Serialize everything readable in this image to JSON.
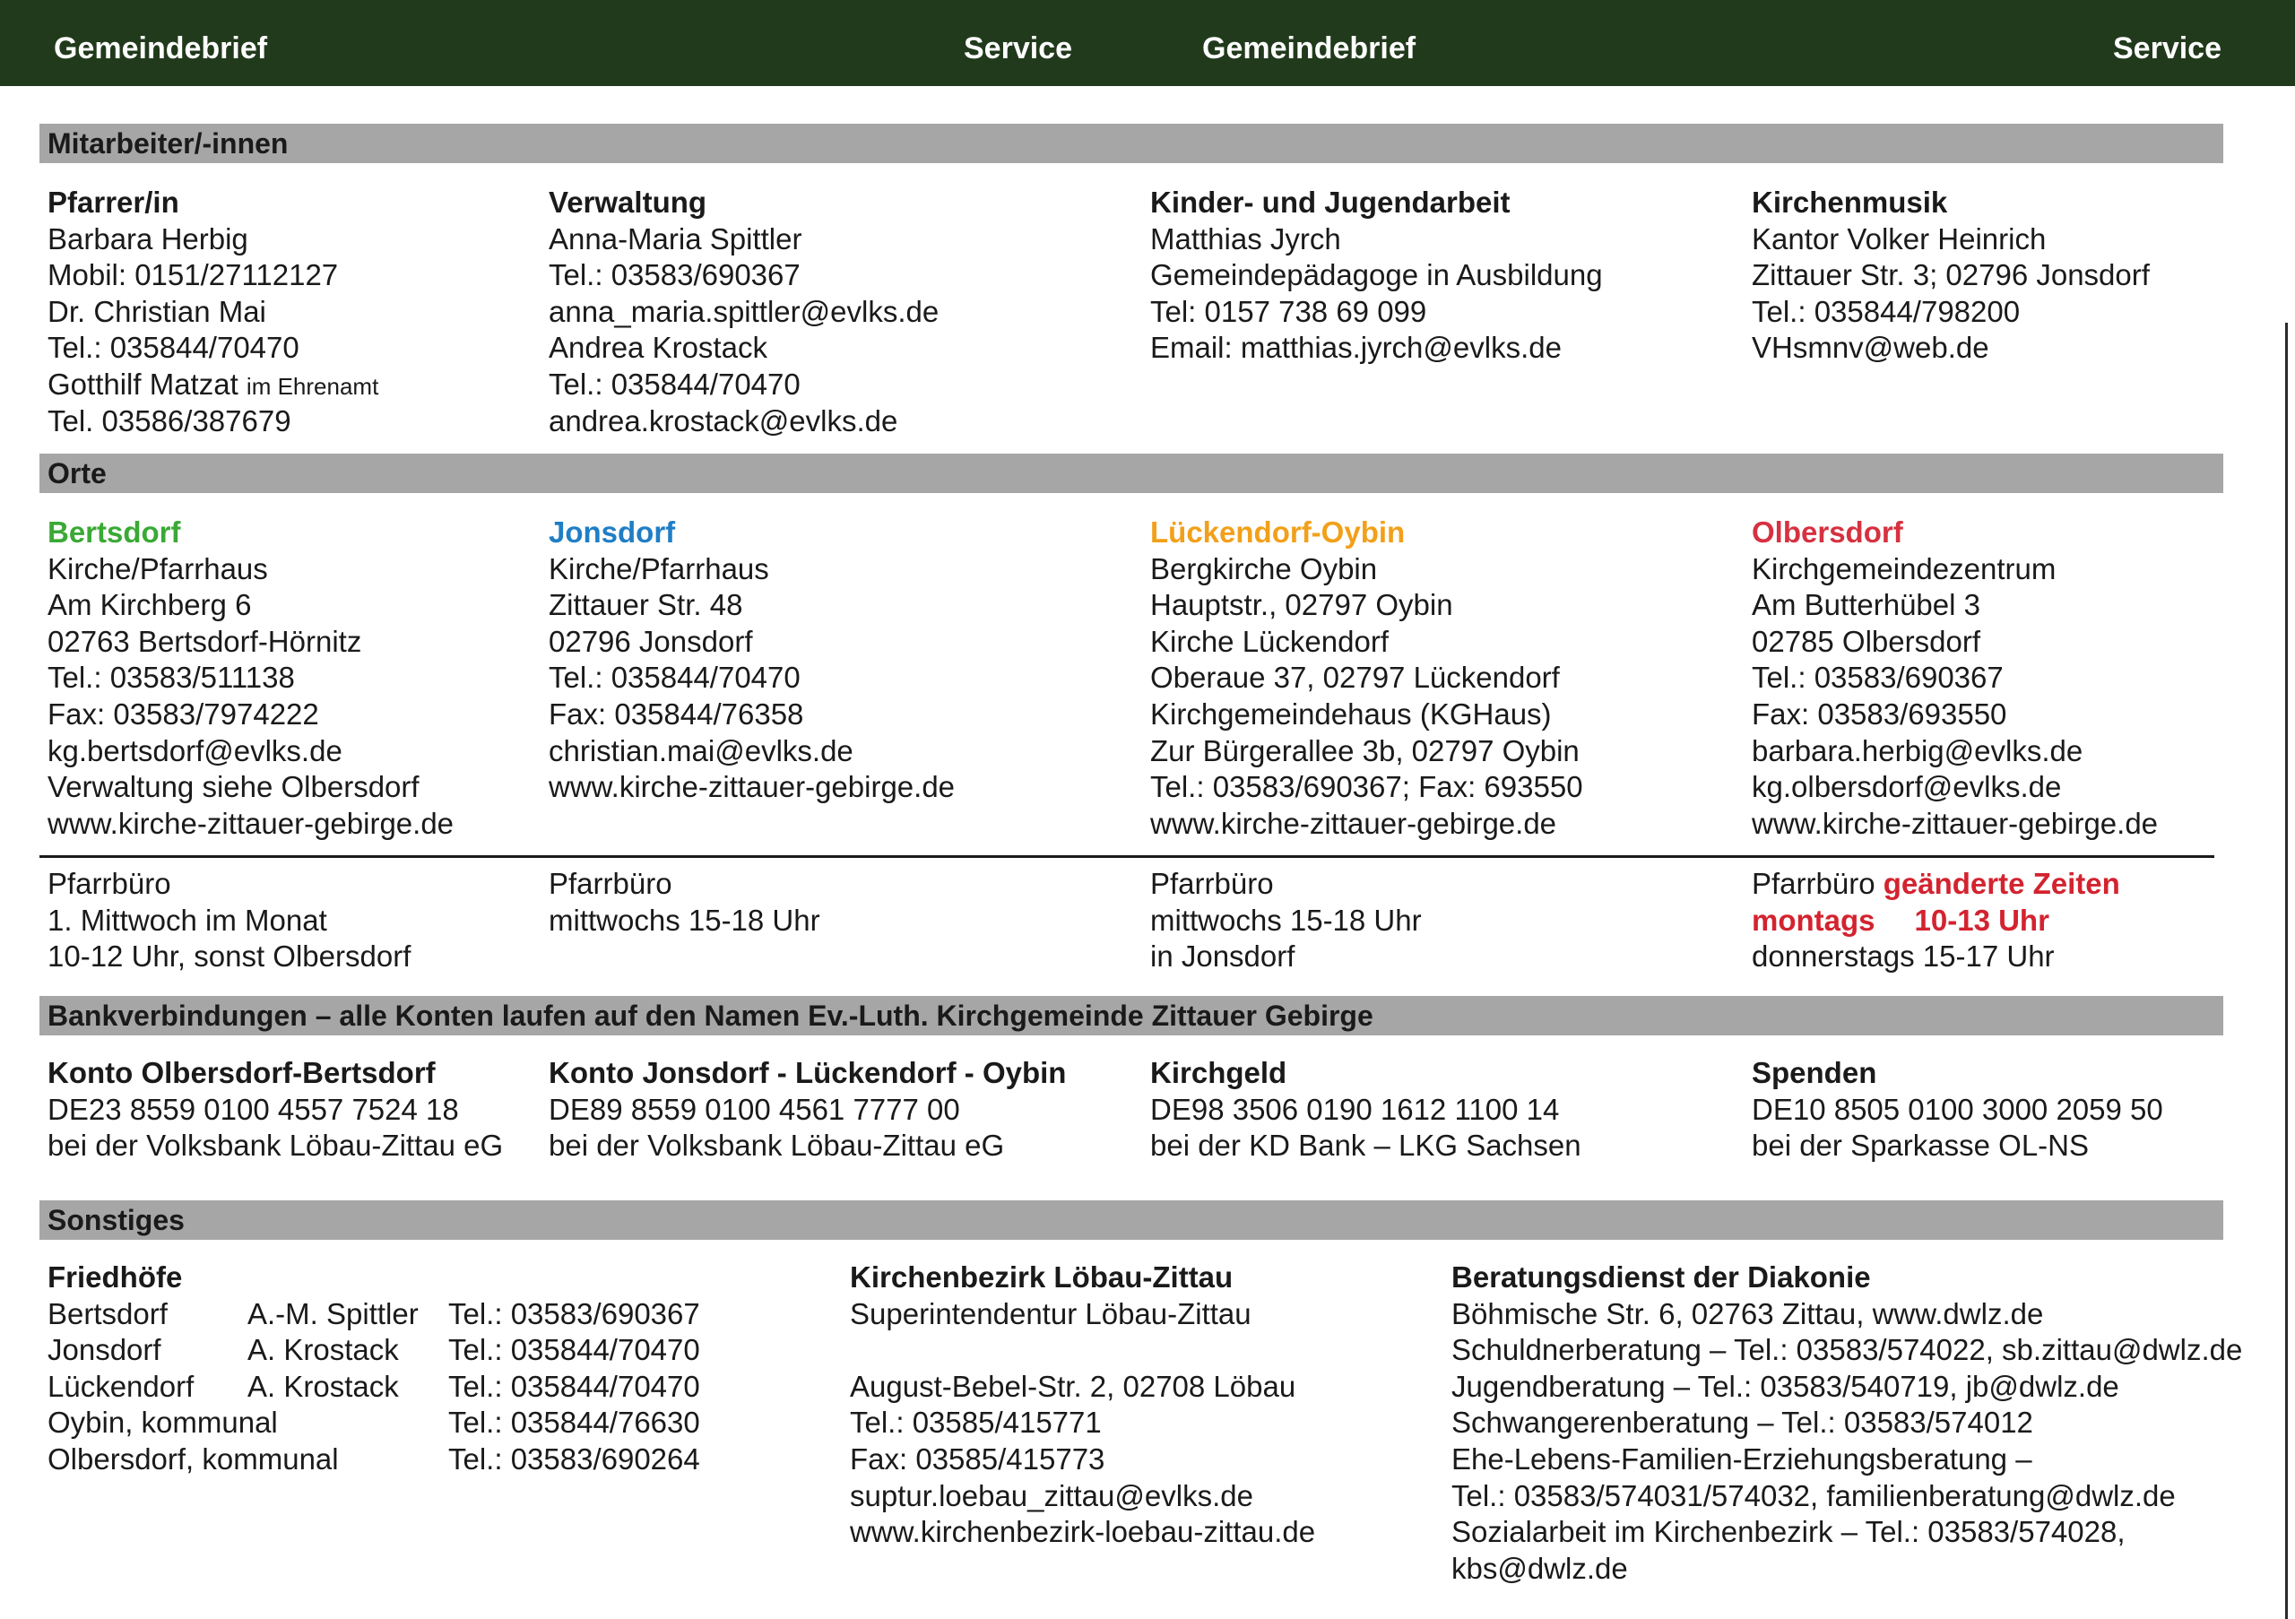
{
  "header": {
    "left_title": "Gemeindebrief",
    "left_section": "Service",
    "right_title": "Gemeindebrief",
    "right_section": "Service"
  },
  "sections": {
    "staff": "Mitarbeiter/-innen",
    "places": "Orte",
    "bank": "Bankverbindungen – alle Konten laufen auf den Namen Ev.-Luth. Kirchgemeinde Zittauer Gebirge",
    "misc": "Sonstiges"
  },
  "staff": {
    "pastor": {
      "heading": "Pfarrer/in",
      "lines": [
        "Barbara Herbig",
        "Mobil: 0151/27112127",
        "Dr. Christian Mai",
        "Tel.: 035844/70470"
      ],
      "honorary_name": "Gotthilf Matzat",
      "honorary_note": "im Ehrenamt",
      "last_line": "Tel. 03586/387679"
    },
    "admin": {
      "heading": "Verwaltung",
      "lines": [
        "Anna-Maria Spittler",
        "Tel.: 03583/690367",
        "anna_maria.spittler@evlks.de",
        "Andrea Krostack",
        "Tel.: 035844/70470",
        "andrea.krostack@evlks.de"
      ]
    },
    "youth": {
      "heading": "Kinder- und Jugendarbeit",
      "lines": [
        "Matthias Jyrch",
        "Gemeindepädagoge in Ausbildung",
        "Tel: 0157 738 69 099",
        "Email: matthias.jyrch@evlks.de"
      ]
    },
    "music": {
      "heading": "Kirchenmusik",
      "lines": [
        "Kantor Volker Heinrich",
        "Zittauer Str. 3; 02796 Jonsdorf",
        "Tel.: 035844/798200",
        "VHsmnv@web.de"
      ]
    }
  },
  "places": {
    "bertsdorf": {
      "name": "Bertsdorf",
      "lines": [
        "Kirche/Pfarrhaus",
        "Am Kirchberg 6",
        "02763 Bertsdorf-Hörnitz",
        "Tel.: 03583/511138",
        "Fax: 03583/7974222",
        "kg.bertsdorf@evlks.de",
        "Verwaltung siehe Olbersdorf",
        "www.kirche-zittauer-gebirge.de"
      ],
      "office": [
        "Pfarrbüro",
        "1. Mittwoch im Monat",
        "10-12 Uhr, sonst Olbersdorf"
      ]
    },
    "jonsdorf": {
      "name": "Jonsdorf",
      "lines": [
        "Kirche/Pfarrhaus",
        "Zittauer Str. 48",
        "02796 Jonsdorf",
        "Tel.: 035844/70470",
        "Fax: 035844/76358",
        "christian.mai@evlks.de",
        "www.kirche-zittauer-gebirge.de"
      ],
      "office": [
        "Pfarrbüro",
        "mittwochs 15-18 Uhr"
      ]
    },
    "lueckendorf": {
      "name": "Lückendorf-Oybin",
      "lines": [
        "Bergkirche Oybin",
        "Hauptstr., 02797 Oybin",
        "Kirche Lückendorf",
        "Oberaue 37, 02797 Lückendorf",
        "Kirchgemeindehaus (KGHaus)",
        "Zur Bürgerallee 3b, 02797 Oybin",
        "Tel.: 03583/690367; Fax: 693550",
        "www.kirche-zittauer-gebirge.de"
      ],
      "office": [
        "Pfarrbüro",
        "mittwochs 15-18 Uhr",
        "in Jonsdorf"
      ]
    },
    "olbersdorf": {
      "name": "Olbersdorf",
      "lines": [
        "Kirchgemeindezentrum",
        "Am Butterhübel 3",
        "02785 Olbersdorf",
        "Tel.: 03583/690367",
        "Fax: 03583/693550",
        "barbara.herbig@evlks.de",
        "kg.olbersdorf@evlks.de",
        "www.kirche-zittauer-gebirge.de"
      ],
      "office_label": "Pfarrbüro",
      "office_changed": "geänderte Zeiten",
      "office_day": "montags",
      "office_time": "10-13 Uhr",
      "office_last": "donnerstags 15-17 Uhr"
    }
  },
  "bank": {
    "ob": {
      "heading": "Konto Olbersdorf-Bertsdorf",
      "iban": "DE23 8559 0100 4557 7524 18",
      "bank": "bei der Volksbank Löbau-Zittau eG"
    },
    "jlo": {
      "heading": "Konto Jonsdorf - Lückendorf - Oybin",
      "iban": "DE89 8559 0100 4561 7777 00",
      "bank": "bei der Volksbank Löbau-Zittau eG"
    },
    "kg": {
      "heading": "Kirchgeld",
      "iban": "DE98 3506 0190 1612 1100 14",
      "bank": "bei der KD Bank – LKG Sachsen"
    },
    "sp": {
      "heading": "Spenden",
      "iban": "DE10 8505 0100 3000 2059 50",
      "bank": "bei der Sparkasse OL-NS"
    }
  },
  "misc": {
    "cemeteries": {
      "heading": "Friedhöfe",
      "rows": [
        {
          "place": "Bertsdorf",
          "contact": "A.-M. Spittler",
          "phone": "Tel.: 03583/690367"
        },
        {
          "place": "Jonsdorf",
          "contact": "A. Krostack",
          "phone": "Tel.: 035844/70470"
        },
        {
          "place": "Lückendorf",
          "contact": "A. Krostack",
          "phone": "Tel.: 035844/70470"
        },
        {
          "place": "Oybin, kommunal",
          "contact": "",
          "phone": "Tel.: 035844/76630"
        },
        {
          "place": "Olbersdorf, kommunal",
          "contact": "",
          "phone": "Tel.: 03583/690264"
        }
      ]
    },
    "district": {
      "heading": "Kirchenbezirk Löbau-Zittau",
      "line1": "Superintendentur Löbau-Zittau",
      "lines": [
        "August-Bebel-Str. 2, 02708 Löbau",
        "Tel.: 03585/415771",
        "Fax: 03585/415773",
        "suptur.loebau_zittau@evlks.de",
        "www.kirchenbezirk-loebau-zittau.de"
      ]
    },
    "diakonie": {
      "heading": "Beratungsdienst der Diakonie",
      "lines": [
        "Böhmische Str. 6, 02763 Zittau, www.dwlz.de",
        "Schuldnerberatung – Tel.: 03583/574022, sb.zittau@dwlz.de",
        "Jugendberatung – Tel.: 03583/540719, jb@dwlz.de",
        "Schwangerenberatung – Tel.: 03583/574012",
        "Ehe-Lebens-Familien-Erziehungsberatung –",
        "Tel.: 03583/574031/574032, familienberatung@dwlz.de",
        "Sozialarbeit im Kirchenbezirk – Tel.: 03583/574028,",
        "kbs@dwlz.de"
      ]
    }
  }
}
